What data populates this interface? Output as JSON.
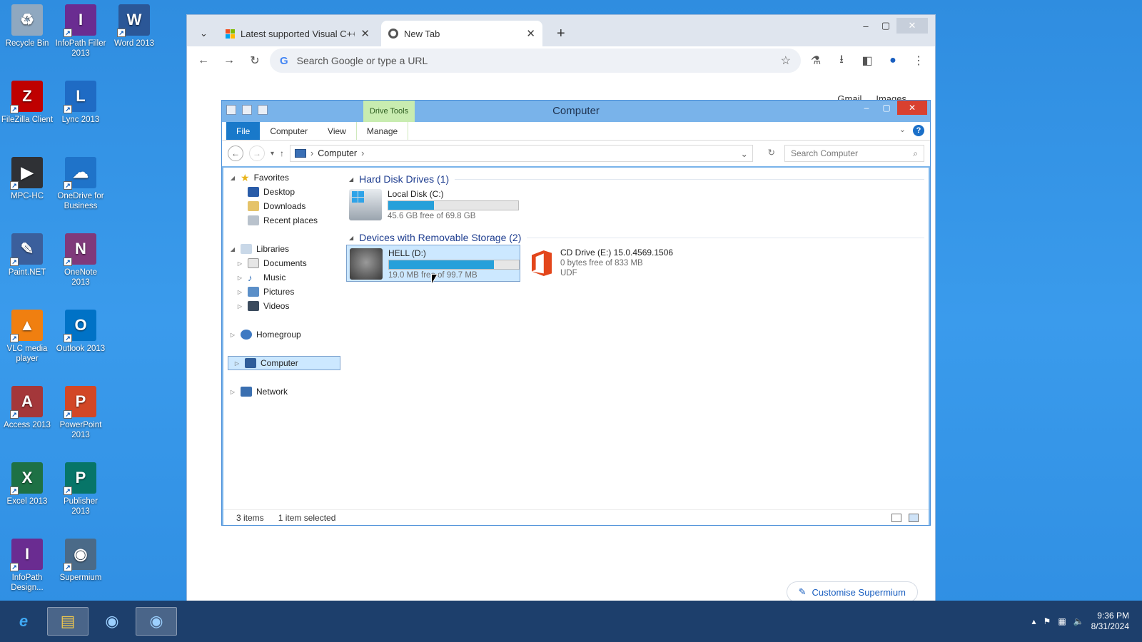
{
  "desktop": {
    "icons": [
      {
        "label": "Recycle Bin",
        "icon": "recycle-bin-icon",
        "color": "#8fa8c0",
        "glyph": "♻"
      },
      {
        "label": "InfoPath Filler 2013",
        "icon": "infopath-filler-icon",
        "color": "#6a2c91",
        "glyph": "I"
      },
      {
        "label": "Word 2013",
        "icon": "word-icon",
        "color": "#2b5797",
        "glyph": "W"
      },
      {
        "label": "FileZilla Client",
        "icon": "filezilla-icon",
        "color": "#bf0000",
        "glyph": "Z"
      },
      {
        "label": "Lync 2013",
        "icon": "lync-icon",
        "color": "#1f6bc4",
        "glyph": "L"
      },
      {
        "label": "MPC-HC",
        "icon": "mpc-hc-icon",
        "color": "#2f3135",
        "glyph": "▶"
      },
      {
        "label": "OneDrive for Business",
        "icon": "onedrive-icon",
        "color": "#1f73c9",
        "glyph": "☁"
      },
      {
        "label": "Paint.NET",
        "icon": "paintnet-icon",
        "color": "#3b5f9c",
        "glyph": "✎"
      },
      {
        "label": "OneNote 2013",
        "icon": "onenote-icon",
        "color": "#80397b",
        "glyph": "N"
      },
      {
        "label": "VLC media player",
        "icon": "vlc-icon",
        "color": "#f07f10",
        "glyph": "▲"
      },
      {
        "label": "Outlook 2013",
        "icon": "outlook-icon",
        "color": "#0072c6",
        "glyph": "O"
      },
      {
        "label": "Access 2013",
        "icon": "access-icon",
        "color": "#a4373a",
        "glyph": "A"
      },
      {
        "label": "PowerPoint 2013",
        "icon": "powerpoint-icon",
        "color": "#d24726",
        "glyph": "P"
      },
      {
        "label": "Excel 2013",
        "icon": "excel-icon",
        "color": "#1e7145",
        "glyph": "X"
      },
      {
        "label": "Publisher 2013",
        "icon": "publisher-icon",
        "color": "#077568",
        "glyph": "P"
      },
      {
        "label": "InfoPath Design...",
        "icon": "infopath-designer-icon",
        "color": "#6a2c91",
        "glyph": "I"
      },
      {
        "label": "Supermium",
        "icon": "supermium-icon",
        "color": "#4a6a88",
        "glyph": "◉"
      }
    ]
  },
  "browser": {
    "tabs": [
      {
        "title": "Latest supported Visual C++ R",
        "close": "✕"
      },
      {
        "title": "New Tab",
        "close": "✕"
      }
    ],
    "new_tab": "+",
    "omnibox_placeholder": "Search Google or type a URL",
    "ntp_links": [
      "Gmail",
      "Images"
    ],
    "customise": "Customise Supermium"
  },
  "explorer": {
    "title": "Computer",
    "contextual_tab": "Drive Tools",
    "ribbon_tabs": [
      "File",
      "Computer",
      "View",
      "Manage"
    ],
    "address": [
      "Computer"
    ],
    "search_placeholder": "Search Computer",
    "nav": {
      "favorites": "Favorites",
      "favorites_items": [
        "Desktop",
        "Downloads",
        "Recent places"
      ],
      "libraries": "Libraries",
      "library_items": [
        "Documents",
        "Music",
        "Pictures",
        "Videos"
      ],
      "homegroup": "Homegroup",
      "computer": "Computer",
      "network": "Network"
    },
    "groups": {
      "hdd": "Hard Disk Drives (1)",
      "removable": "Devices with Removable Storage (2)"
    },
    "drives": {
      "c": {
        "name": "Local Disk (C:)",
        "free": "45.6 GB free of 69.8 GB",
        "used_fraction": 0.35
      },
      "d": {
        "name": "HELL (D:)",
        "free": "19.0 MB free of 99.7 MB",
        "used_fraction": 0.81
      },
      "e": {
        "name": "CD Drive (E:) 15.0.4569.1506",
        "free": "0 bytes free of 833 MB",
        "fs": "UDF"
      }
    },
    "status": {
      "items": "3 items",
      "selected": "1 item selected"
    }
  },
  "taskbar": {
    "time": "9:36 PM",
    "date": "8/31/2024"
  }
}
